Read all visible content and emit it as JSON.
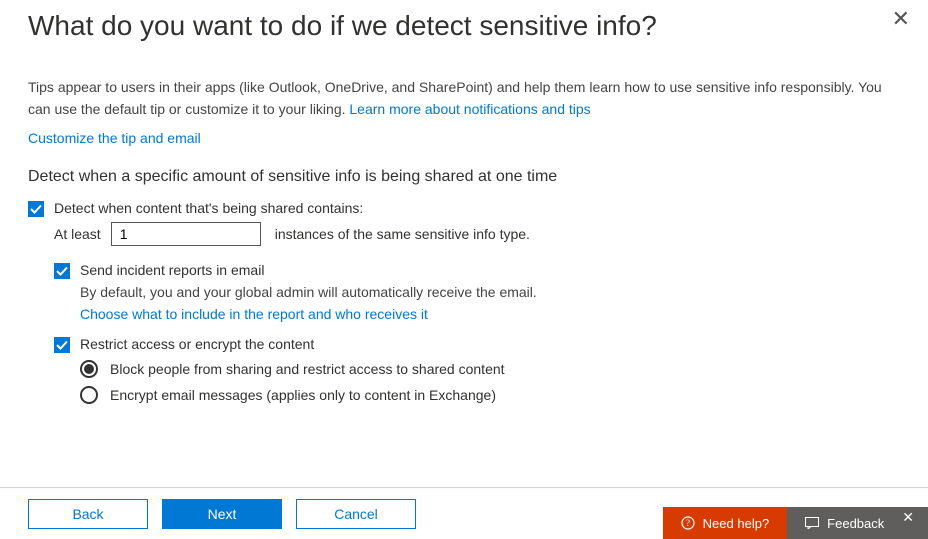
{
  "header": {
    "title": "What do you want to do if we detect sensitive info?"
  },
  "tips": {
    "line": "Tips appear to users in their apps (like Outlook, OneDrive, and SharePoint) and help them learn how to use sensitive info responsibly. You can use the default tip or customize it to your liking.",
    "learn_more": "Learn more about notifications and tips",
    "customize_link": "Customize the tip and email"
  },
  "section": {
    "heading": "Detect when a specific amount of sensitive info is being shared at one time"
  },
  "detect": {
    "label": "Detect when content that's being shared contains:",
    "at_least_label": "At least",
    "at_least_value": "1",
    "at_least_suffix": "instances of the same sensitive info type."
  },
  "incident": {
    "label": "Send incident reports in email",
    "desc": "By default, you and your global admin will automatically receive the email.",
    "link": "Choose what to include in the report and who receives it"
  },
  "restrict": {
    "label": "Restrict access or encrypt the content",
    "option_block": "Block people from sharing and restrict access to shared content",
    "option_encrypt": "Encrypt email messages (applies only to content in Exchange)"
  },
  "footer": {
    "back": "Back",
    "next": "Next",
    "cancel": "Cancel",
    "need_help": "Need help?",
    "feedback": "Feedback"
  }
}
